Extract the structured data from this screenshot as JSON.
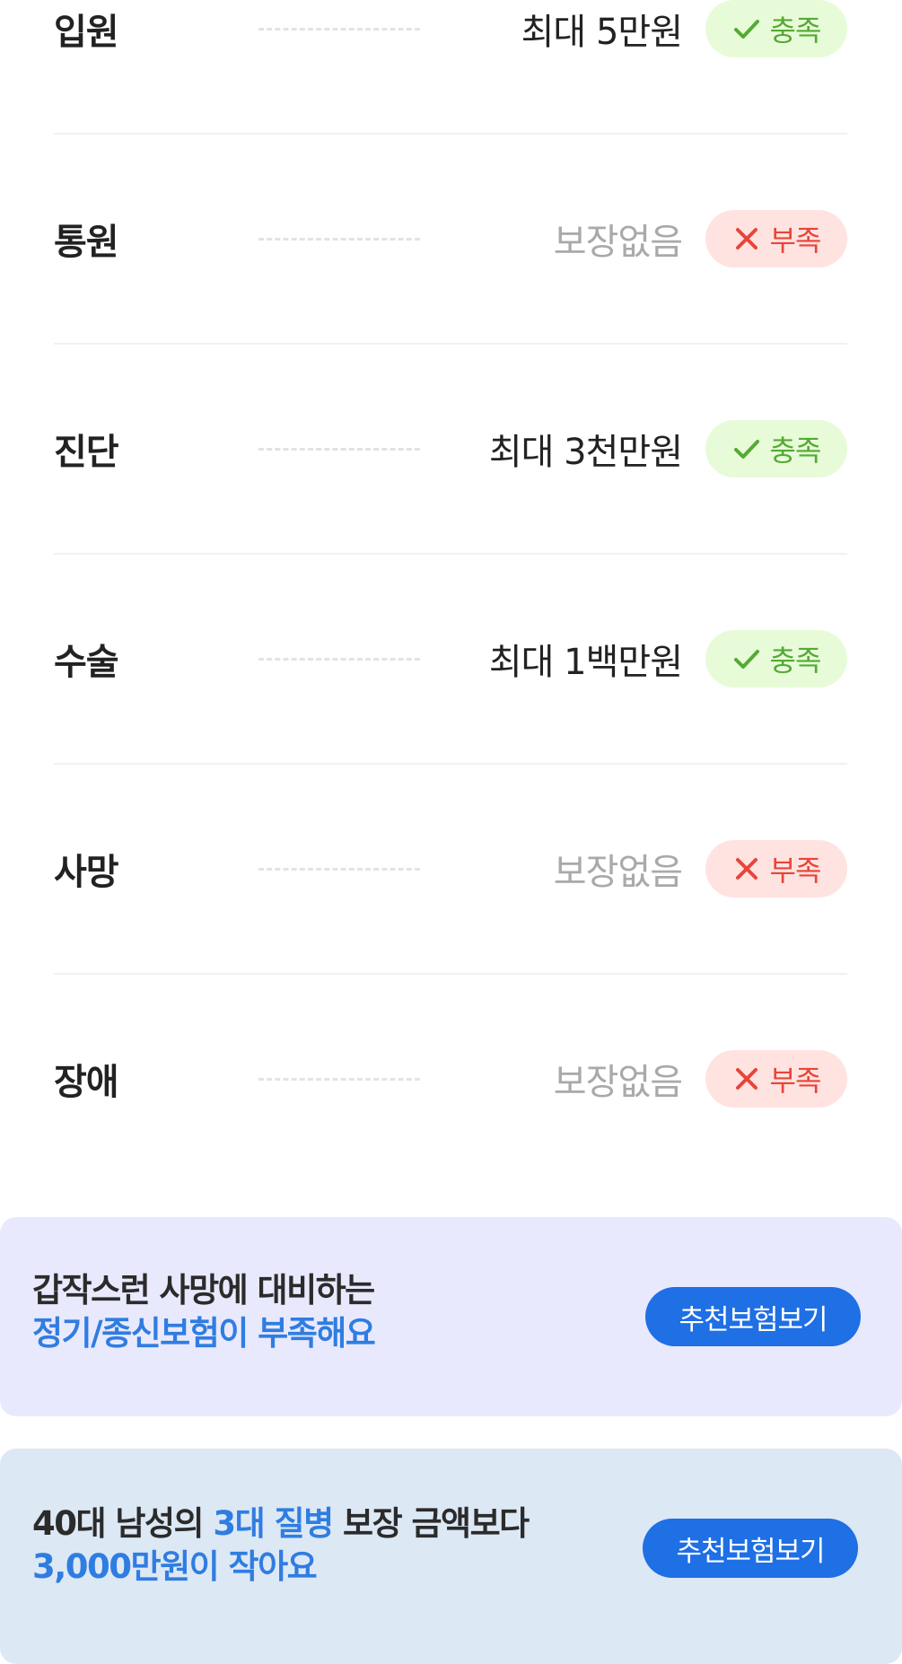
{
  "coverage_rows": [
    {
      "category": "입원",
      "value": "최대 5만원",
      "status": "충족",
      "ok": true
    },
    {
      "category": "통원",
      "value": "보장없음",
      "status": "부족",
      "ok": false
    },
    {
      "category": "진단",
      "value": "최대 3천만원",
      "status": "충족",
      "ok": true
    },
    {
      "category": "수술",
      "value": "최대 1백만원",
      "status": "충족",
      "ok": true
    },
    {
      "category": "사망",
      "value": "보장없음",
      "status": "부족",
      "ok": false
    },
    {
      "category": "장애",
      "value": "보장없음",
      "status": "부족",
      "ok": false
    }
  ],
  "cards": [
    {
      "line1_dark": "갑작스런 사망에 대비하는",
      "line2_blue": "정기/종신보험이 부족해요",
      "cta_label": "추천보험보기",
      "background": "#e9e9fd"
    },
    {
      "line1_dark_a": "40대 남성의 ",
      "line1_blue": "3대 질병",
      "line1_dark_b": " 보장 금액보다",
      "line2_blue": "3,000만원이 작아요",
      "cta_label": "추천보험보기",
      "background": "#dde8f5"
    }
  ],
  "colors": {
    "ok_bg": "#e8fbd9",
    "ok_text": "#55aa33",
    "no_bg": "#ffe3e1",
    "no_text": "#e8453a",
    "accent_blue": "#2f7de1",
    "cta_blue": "#1f6fe5",
    "muted_text": "#a9a9a9"
  },
  "icons": {
    "ok": "check-icon",
    "no": "close-icon"
  }
}
